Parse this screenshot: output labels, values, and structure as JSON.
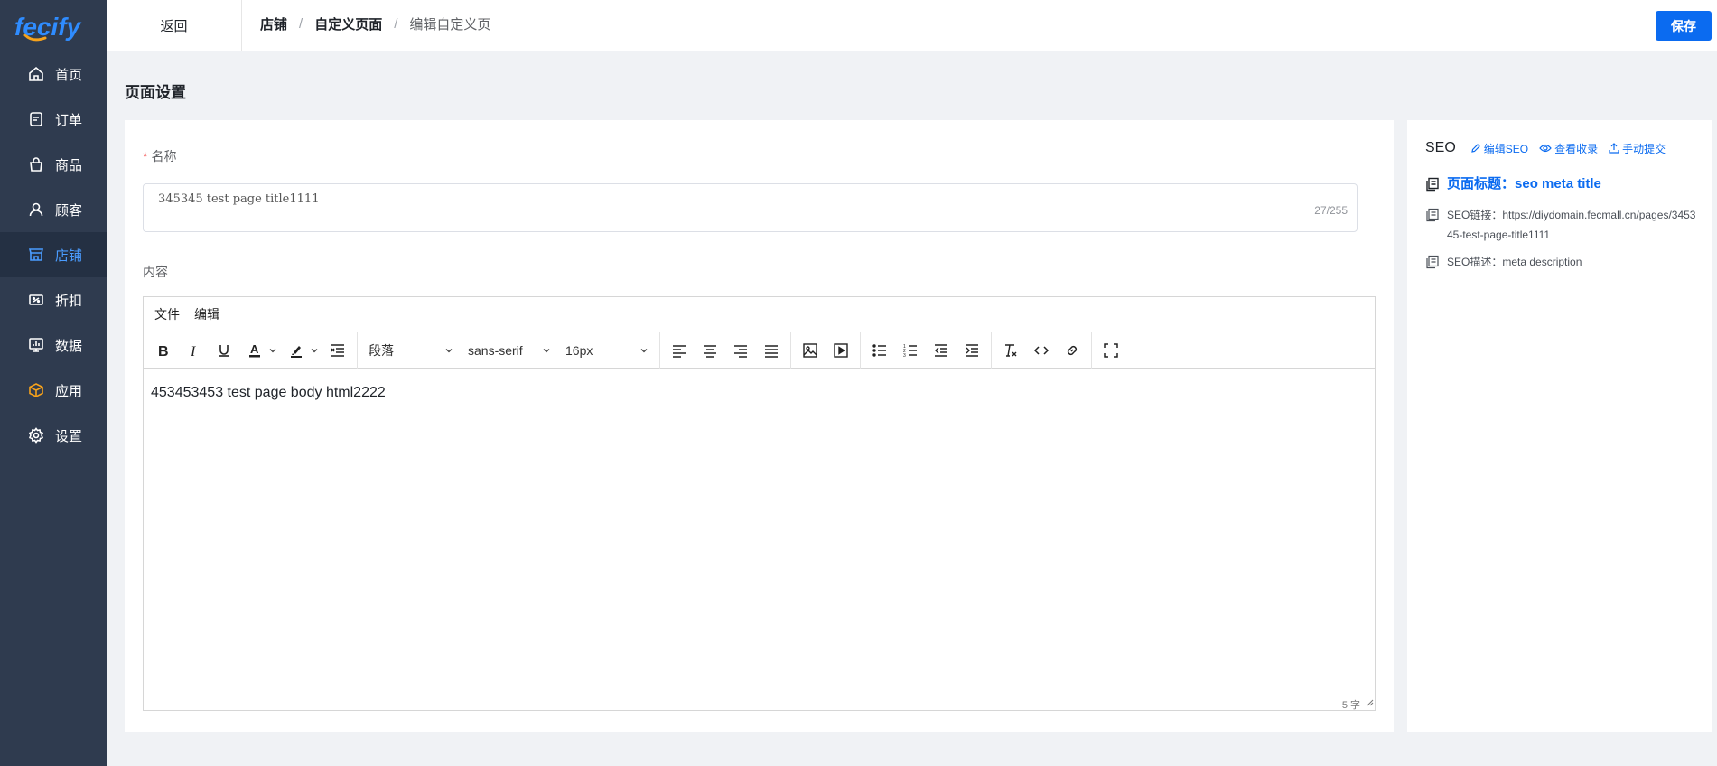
{
  "app": {
    "logo_text": "fecify"
  },
  "sidebar": {
    "items": [
      {
        "label": "首页",
        "icon": "home-icon"
      },
      {
        "label": "订单",
        "icon": "order-icon"
      },
      {
        "label": "商品",
        "icon": "bag-icon"
      },
      {
        "label": "顾客",
        "icon": "user-icon"
      },
      {
        "label": "店铺",
        "icon": "store-icon",
        "active": true
      },
      {
        "label": "折扣",
        "icon": "discount-icon"
      },
      {
        "label": "数据",
        "icon": "chart-icon"
      },
      {
        "label": "应用",
        "icon": "app-box-icon"
      },
      {
        "label": "设置",
        "icon": "gear-icon"
      }
    ]
  },
  "header": {
    "back_label": "返回",
    "breadcrumb": [
      "店铺",
      "自定义页面",
      "编辑自定义页"
    ],
    "save_label": "保存"
  },
  "main": {
    "page_title": "页面设置",
    "name_field": {
      "required_mark": "*",
      "label": "名称",
      "value": "345345  test page title1111",
      "counter": "27/255"
    },
    "content_label": "内容",
    "editor": {
      "menus": [
        "文件",
        "编辑"
      ],
      "block_format": "段落",
      "font_family": "sans-serif",
      "font_size": "16px",
      "body_text": "453453453 test page body html2222",
      "word_count": "5 字"
    }
  },
  "seo": {
    "title": "SEO",
    "actions": {
      "edit": "编辑SEO",
      "view": "查看收录",
      "submit": "手动提交"
    },
    "page_title_label": "页面标题：",
    "page_title_value": "seo meta title",
    "link_label": "SEO链接：",
    "link_value": "https://diydomain.fecmall.cn/pages/345345-test-page-title1111",
    "desc_label": "SEO描述：",
    "desc_value": "meta description"
  },
  "colors": {
    "primary": "#0b6bf0",
    "sidebar_bg": "#2f3b4f",
    "sidebar_active_bg": "#243043",
    "active_text": "#4a9cff"
  }
}
